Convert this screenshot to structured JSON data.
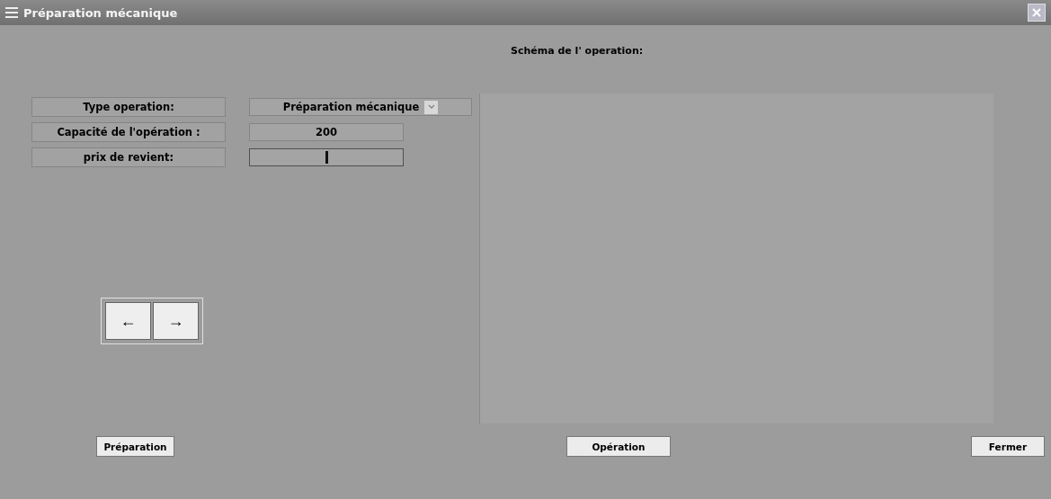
{
  "window": {
    "title": "Préparation mécanique"
  },
  "form": {
    "fields": [
      {
        "label": "Type operation:",
        "kind": "dropdown",
        "value": "Préparation mécanique"
      },
      {
        "label": "Capacité de l'opération :",
        "kind": "text",
        "value": "200"
      },
      {
        "label": "prix de revient:",
        "kind": "text",
        "focused": true
      }
    ]
  },
  "navigation": [
    "←",
    "→"
  ],
  "schema": {
    "heading": "Schéma de l' operation:"
  },
  "buttons": [
    "Préparation",
    "Opération",
    "Fermer"
  ]
}
